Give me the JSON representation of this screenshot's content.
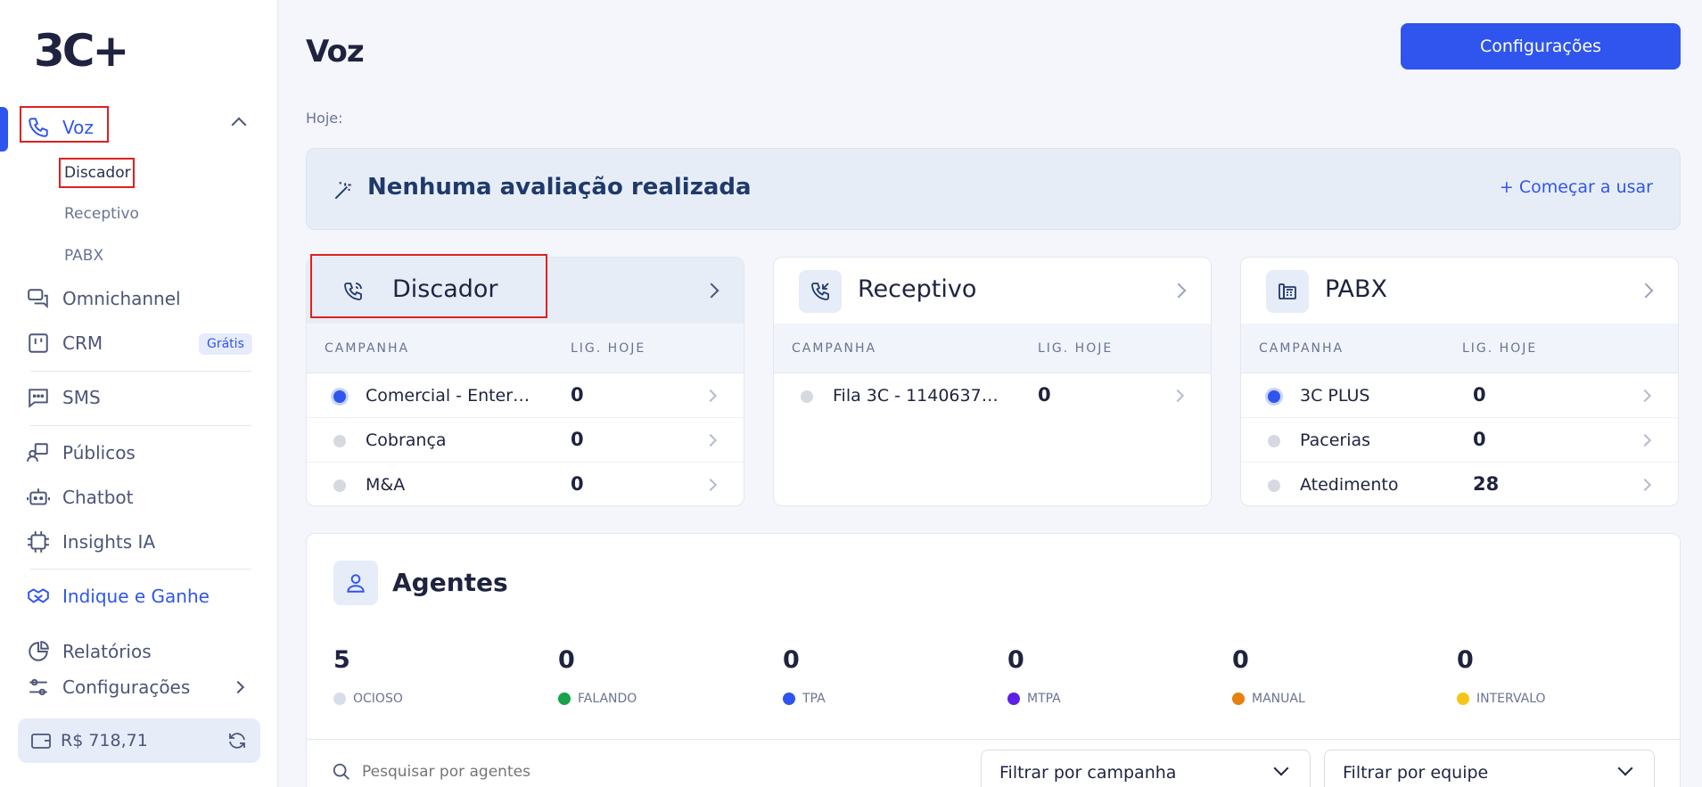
{
  "brand": {
    "logo": "3C+"
  },
  "sidebar": {
    "voz": "Voz",
    "sub": [
      "Discador",
      "Receptivo",
      "PABX"
    ],
    "omnichannel": "Omnichannel",
    "crm": "CRM",
    "crm_badge": "Grátis",
    "sms": "SMS",
    "publicos": "Públicos",
    "chatbot": "Chatbot",
    "insights": "Insights IA",
    "indique": "Indique e Ganhe",
    "relatorios": "Relatórios",
    "configuracoes": "Configurações",
    "balance": "R$ 718,71"
  },
  "header": {
    "title": "Voz",
    "config_button": "Configurações",
    "today_label": "Hoje:"
  },
  "evaluation": {
    "title": "Nenhuma avaliação realizada",
    "action": "+ Começar a usar"
  },
  "cards": [
    {
      "title": "Discador",
      "col_campaign": "CAMPANHA",
      "col_calls": "LIG. HOJE",
      "rows": [
        {
          "name": "Comercial - Enter…",
          "value": "0",
          "active": true
        },
        {
          "name": "Cobrança",
          "value": "0",
          "active": false
        },
        {
          "name": "M&A",
          "value": "0",
          "active": false
        }
      ]
    },
    {
      "title": "Receptivo",
      "col_campaign": "CAMPANHA",
      "col_calls": "LIG. HOJE",
      "rows": [
        {
          "name": "Fila 3C - 1140637…",
          "value": "0",
          "active": false
        }
      ]
    },
    {
      "title": "PABX",
      "col_campaign": "CAMPANHA",
      "col_calls": "LIG. HOJE",
      "rows": [
        {
          "name": "3C PLUS",
          "value": "0",
          "active": true
        },
        {
          "name": "Pacerias",
          "value": "0",
          "active": false
        },
        {
          "name": "Atedimento",
          "value": "28",
          "active": false
        }
      ]
    }
  ],
  "agents": {
    "title": "Agentes",
    "stats": [
      {
        "value": "5",
        "label": "OCIOSO",
        "color": "#d6ddeb"
      },
      {
        "value": "0",
        "label": "FALANDO",
        "color": "#16a34a"
      },
      {
        "value": "0",
        "label": "TPA",
        "color": "#2f55ee"
      },
      {
        "value": "0",
        "label": "MTPA",
        "color": "#5b21e6"
      },
      {
        "value": "0",
        "label": "MANUAL",
        "color": "#e6800e"
      },
      {
        "value": "0",
        "label": "INTERVALO",
        "color": "#f5c518"
      }
    ],
    "search_placeholder": "Pesquisar por agentes",
    "filter_campaign": "Filtrar por campanha",
    "filter_team": "Filtrar por equipe"
  }
}
